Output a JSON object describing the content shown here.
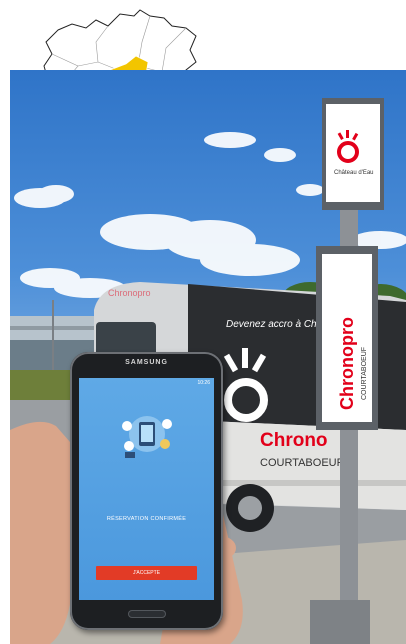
{
  "phone": {
    "brand": "SAMSUNG",
    "status_time": "10:26",
    "confirmation_text": "RÉSERVATION CONFIRMÉE",
    "accept_label": "J'ACCEPTE"
  },
  "minibus": {
    "side_slogan": "Devenez accro à Chrono",
    "logo_text": "Chrono",
    "sub_text": "COURTABOEUF",
    "rear_logo": "Chronopro"
  },
  "sign_panel": {
    "top_text": "Château d'Eau",
    "vertical_logo": "Chronopro",
    "vertical_sub": "COURTABOEUF"
  },
  "colors": {
    "highlight_region": "#f2c500",
    "chrono_red": "#e2001a",
    "sky": "#4d8fd8",
    "screen_blue": "#4b98dd"
  }
}
